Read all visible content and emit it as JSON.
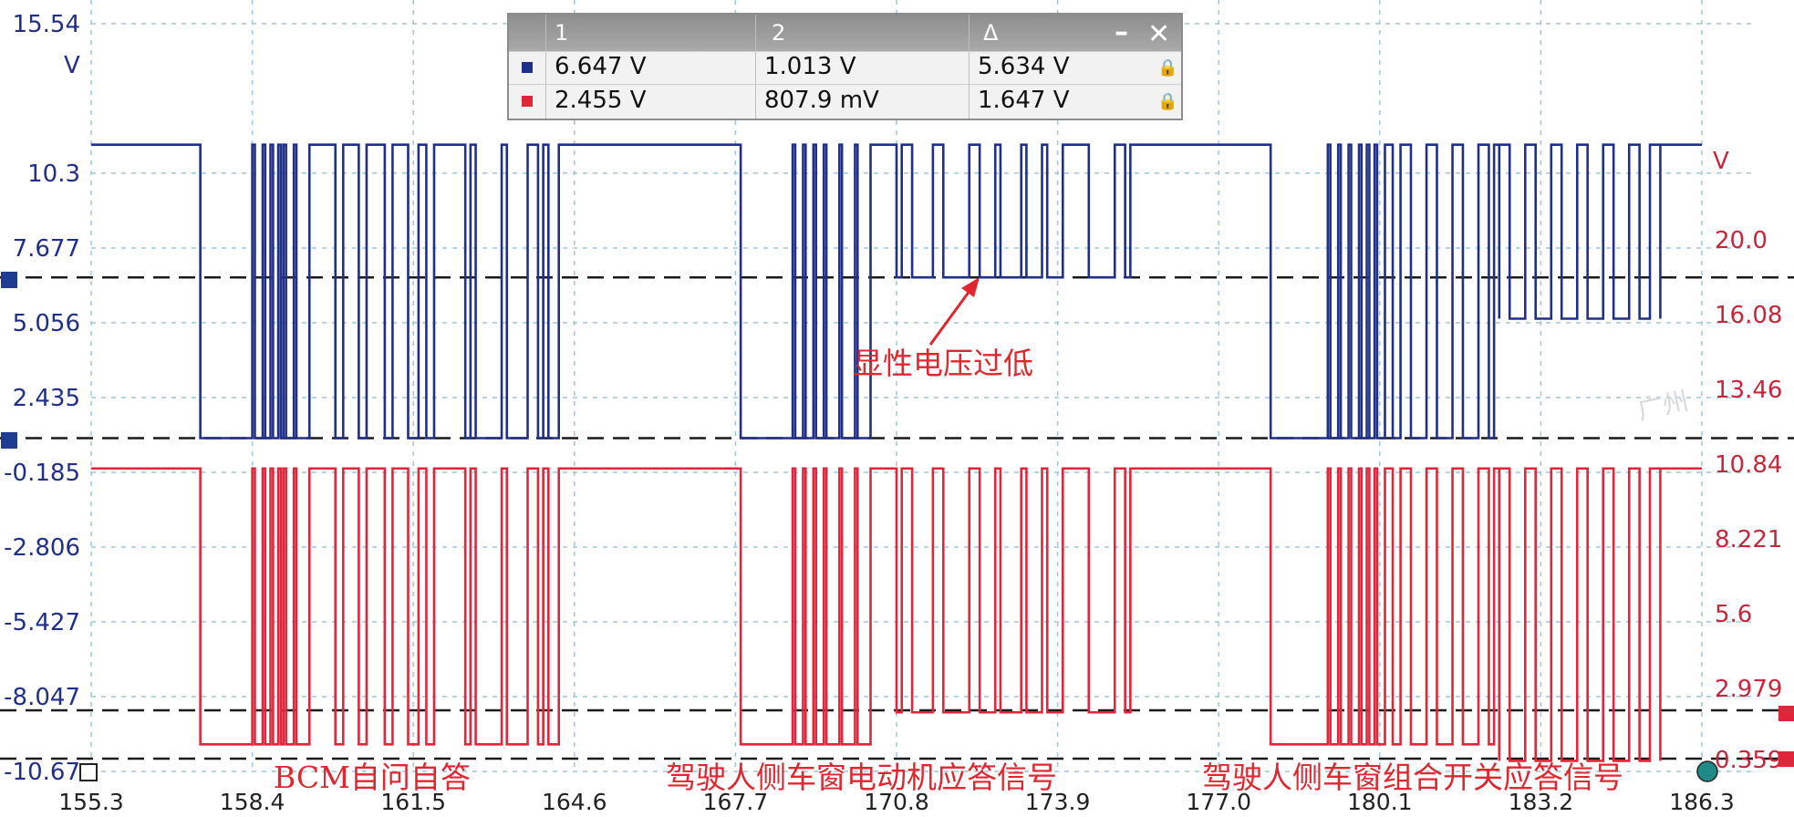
{
  "colors": {
    "ch1": "#1f2f8a",
    "ch2": "#e0263a",
    "grid": "#9fc6da",
    "marker": "#1a1a1a"
  },
  "measurements": {
    "headers": [
      "1",
      "2",
      "Δ"
    ],
    "rows": [
      {
        "channel": "blue",
        "v1": "6.647 V",
        "v2": "1.013 V",
        "delta": "5.634 V"
      },
      {
        "channel": "red",
        "v1": "2.455 V",
        "v2": "807.9 mV",
        "delta": "1.647 V"
      }
    ],
    "minimize_icon": "minimize-icon",
    "close_icon": "close-icon",
    "lock_icon": "lock-icon"
  },
  "annotations": {
    "arrow_label": "显性电压过低",
    "segment_1": "BCM自问自答",
    "segment_2": "驾驶人侧车窗电动机应答信号",
    "segment_3": "驾驶人侧车窗组合开关应答信号"
  },
  "watermark": "广州",
  "chart_data": {
    "type": "line",
    "x_ticks": [
      "155.3",
      "158.4",
      "161.5",
      "164.6",
      "167.7",
      "170.8",
      "173.9",
      "177.0",
      "180.1",
      "183.2",
      "186.3"
    ],
    "xlim": [
      155.3,
      186.3
    ],
    "left_axis": {
      "unit": "V",
      "ticks": [
        "15.54",
        "10.3",
        "7.677",
        "5.056",
        "2.435",
        "-0.185",
        "-2.806",
        "-5.427",
        "-8.047",
        "-10.67"
      ],
      "ylim": [
        -10.67,
        15.54
      ]
    },
    "right_axis": {
      "unit": "V",
      "ticks": [
        "20.0",
        "16.08",
        "13.46",
        "10.84",
        "8.221",
        "5.6",
        "2.979",
        "0.359"
      ]
    },
    "cursors_left_axis": [
      6.647,
      1.013
    ],
    "cursors_red_scale": [
      2.455,
      0.8079
    ],
    "series": [
      {
        "color": "blue",
        "high": 11.3,
        "idle": 1.013,
        "bursts": [
          {
            "x0": 157.4,
            "x1": 161.9,
            "low": 1.013,
            "edges": [
              158.4,
              158.45,
              158.6,
              158.65,
              158.75,
              158.8,
              158.9,
              158.95,
              159.0,
              159.05,
              159.2,
              159.25,
              159.5,
              160.0,
              160.15,
              160.45,
              160.6,
              160.95,
              161.1,
              161.4,
              161.6,
              161.75
            ]
          },
          {
            "x0": 162.5,
            "x1": 164.3,
            "low": 1.013,
            "edges": [
              162.6,
              162.7,
              163.2,
              163.3,
              163.7,
              163.9,
              164.0,
              164.1
            ]
          },
          {
            "x0": 167.8,
            "x1": 170.4,
            "low": 1.013,
            "edges": [
              168.8,
              168.85,
              169.0,
              169.05,
              169.2,
              169.25,
              169.4,
              169.45,
              169.7,
              169.75,
              170.0,
              170.05,
              170.3
            ]
          },
          {
            "x0": 170.8,
            "x1": 175.3,
            "low": 6.647,
            "edges": [
              170.9,
              171.1,
              171.5,
              171.7,
              172.2,
              172.4,
              172.7,
              172.8,
              173.2,
              173.3,
              173.6,
              173.7,
              174.0,
              174.5,
              175.0,
              175.2
            ]
          },
          {
            "x0": 178.0,
            "x1": 182.3,
            "low": 1.013,
            "edges": [
              179.1,
              179.15,
              179.3,
              179.35,
              179.5,
              179.55,
              179.7,
              179.75,
              179.85,
              179.9,
              180.0,
              180.05,
              180.2,
              180.35,
              180.5,
              180.7,
              181.0,
              181.2,
              181.5,
              181.7,
              182.0,
              182.2
            ]
          },
          {
            "x0": 182.4,
            "x1": 185.5,
            "low": 5.2,
            "edges": [
              182.4,
              182.6,
              182.9,
              183.1,
              183.4,
              183.6,
              183.9,
              184.1,
              184.4,
              184.6,
              184.9,
              185.1,
              185.3,
              185.5
            ]
          }
        ]
      },
      {
        "color": "red",
        "high": -0.05,
        "idle": -9.72,
        "bursts": [
          {
            "x0": 157.4,
            "x1": 161.9,
            "low": -9.72,
            "edges": [
              158.4,
              158.45,
              158.6,
              158.65,
              158.75,
              158.8,
              158.9,
              158.95,
              159.0,
              159.05,
              159.2,
              159.25,
              159.5,
              160.0,
              160.15,
              160.45,
              160.6,
              160.95,
              161.1,
              161.4,
              161.6,
              161.75
            ]
          },
          {
            "x0": 162.5,
            "x1": 164.3,
            "low": -9.72,
            "edges": [
              162.6,
              162.7,
              163.2,
              163.3,
              163.7,
              163.9,
              164.0,
              164.1
            ]
          },
          {
            "x0": 167.8,
            "x1": 170.4,
            "low": -9.72,
            "edges": [
              168.8,
              168.85,
              169.0,
              169.05,
              169.2,
              169.25,
              169.4,
              169.45,
              169.7,
              169.75,
              170.0,
              170.05,
              170.3
            ]
          },
          {
            "x0": 170.8,
            "x1": 175.3,
            "low": -8.6,
            "edges": [
              170.9,
              171.1,
              171.5,
              171.7,
              172.2,
              172.4,
              172.7,
              172.8,
              173.2,
              173.3,
              173.6,
              173.7,
              174.0,
              174.5,
              175.0,
              175.2
            ]
          },
          {
            "x0": 178.0,
            "x1": 182.3,
            "low": -9.72,
            "edges": [
              179.1,
              179.15,
              179.3,
              179.35,
              179.5,
              179.55,
              179.7,
              179.75,
              179.85,
              179.9,
              180.0,
              180.05,
              180.2,
              180.35,
              180.5,
              180.7,
              181.0,
              181.2,
              181.5,
              181.7,
              182.0,
              182.2
            ]
          },
          {
            "x0": 182.4,
            "x1": 185.5,
            "low": -10.3,
            "edges": [
              182.4,
              182.6,
              182.9,
              183.1,
              183.4,
              183.6,
              183.9,
              184.1,
              184.4,
              184.6,
              184.9,
              185.1,
              185.3,
              185.5
            ]
          }
        ]
      }
    ],
    "grid": true
  }
}
